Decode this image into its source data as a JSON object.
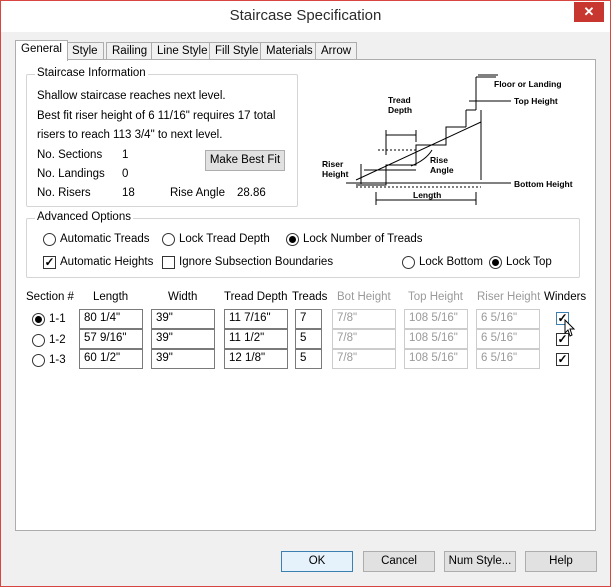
{
  "window": {
    "title": "Staircase Specification",
    "close_label": "✕"
  },
  "tabs": [
    "General",
    "Style",
    "Railing",
    "Line Style",
    "Fill Style",
    "Materials",
    "Arrow"
  ],
  "info": {
    "title": "Staircase Information",
    "line1": "Shallow staircase reaches next level.",
    "line2": "Best fit riser height of 6 11/16\" requires 17 total",
    "line3": "risers to reach 113 3/4\" to next level.",
    "sections_label": "No. Sections",
    "sections_value": "1",
    "landings_label": "No. Landings",
    "landings_value": "0",
    "risers_label": "No. Risers",
    "risers_value": "18",
    "angle_label": "Rise Angle",
    "angle_value": "28.86",
    "best_fit_label": "Make Best Fit"
  },
  "diagram": {
    "floor": "Floor or Landing",
    "tread_depth_1": "Tread",
    "tread_depth_2": "Depth",
    "top_height": "Top Height",
    "riser_height_1": "Riser",
    "riser_height_2": "Height",
    "rise_angle_1": "Rise",
    "rise_angle_2": "Angle",
    "bottom_height": "Bottom Height",
    "length": "Length"
  },
  "advanced": {
    "title": "Advanced Options",
    "auto_treads": "Automatic Treads",
    "lock_tread_depth": "Lock Tread Depth",
    "lock_num_treads": "Lock Number of Treads",
    "auto_heights": "Automatic Heights",
    "ignore_subsection": "Ignore Subsection Boundaries",
    "lock_bottom": "Lock Bottom",
    "lock_top": "Lock Top",
    "selected_tread_mode": "lock_num_treads",
    "selected_lock": "lock_top",
    "auto_heights_checked": true,
    "ignore_subsection_checked": false
  },
  "table": {
    "headers": {
      "section": "Section #",
      "length": "Length",
      "width": "Width",
      "tread_depth": "Tread Depth",
      "treads": "Treads",
      "bot_height": "Bot Height",
      "top_height": "Top Height",
      "riser_height": "Riser Height",
      "winders": "Winders"
    },
    "rows": [
      {
        "section": "1-1",
        "selected": true,
        "length": "80 1/4\"",
        "width": "39\"",
        "tread_depth": "11 7/16\"",
        "treads": "7",
        "bot_height": "7/8\"",
        "top_height": "108 5/16\"",
        "riser_height": "6 5/16\"",
        "winders": true
      },
      {
        "section": "1-2",
        "selected": false,
        "length": "57 9/16\"",
        "width": "39\"",
        "tread_depth": "11 1/2\"",
        "treads": "5",
        "bot_height": "7/8\"",
        "top_height": "108 5/16\"",
        "riser_height": "6 5/16\"",
        "winders": true
      },
      {
        "section": "1-3",
        "selected": false,
        "length": "60 1/2\"",
        "width": "39\"",
        "tread_depth": "12 1/8\"",
        "treads": "5",
        "bot_height": "7/8\"",
        "top_height": "108 5/16\"",
        "riser_height": "6 5/16\"",
        "winders": true
      }
    ]
  },
  "buttons": {
    "ok": "OK",
    "cancel": "Cancel",
    "num_style": "Num Style...",
    "help": "Help"
  },
  "check_mark": "✓"
}
